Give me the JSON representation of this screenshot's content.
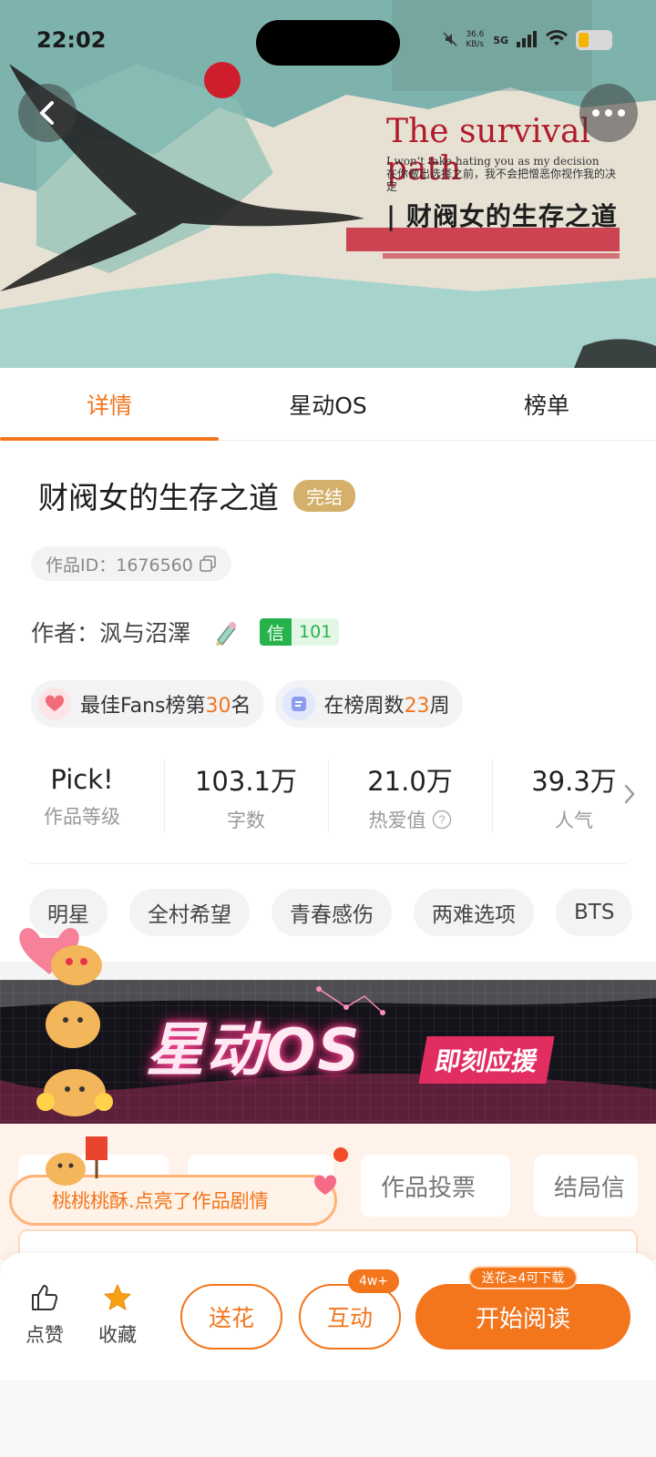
{
  "status_bar": {
    "time": "22:02",
    "net_speed": "36.6 KB/s",
    "network": "5G"
  },
  "cover": {
    "title_en": "The survival path",
    "subtitle_en": "I won't take hating you as my decision",
    "subtitle_cn": "在你做出选择之前，我不会把憎恶你视作我的决定",
    "title_cn": "| 财阀女的生存之道"
  },
  "tabs": [
    {
      "label": "详情"
    },
    {
      "label": "星动OS"
    },
    {
      "label": "榜单"
    }
  ],
  "book": {
    "title": "财阀女的生存之道",
    "status_badge": "完结",
    "id_label": "作品ID：1676560",
    "author_label": "作者：沨与沼澤",
    "credit_label": "信",
    "credit_value": "101"
  },
  "ranks": [
    {
      "prefix": "最佳Fans榜第",
      "num": "30",
      "suffix": "名"
    },
    {
      "prefix": "在榜周数",
      "num": "23",
      "suffix": "周"
    }
  ],
  "stats": [
    {
      "value": "Pick!",
      "label": "作品等级"
    },
    {
      "value": "103.1万",
      "label": "字数"
    },
    {
      "value": "21.0万",
      "label": "热爱值"
    },
    {
      "value": "39.3万",
      "label": "人气"
    }
  ],
  "tags": [
    "明星",
    "全村希望",
    "青春感伤",
    "两难选项",
    "BTS"
  ],
  "banner": {
    "title": "星动OS",
    "cta": "即刻应援"
  },
  "lower_tabs": [
    "作品投票",
    "结局信"
  ],
  "toast": "桃桃桃酥.点亮了作品剧情",
  "bottom_bar": {
    "like": "点赞",
    "favorite": "收藏",
    "flower": "送花",
    "interact": "互动",
    "interact_badge": "4w+",
    "read": "开始阅读",
    "read_badge": "送花≥4可下载"
  },
  "colors": {
    "accent": "#f3751c",
    "badge_gold": "#d4b06a",
    "credit_green": "#27b34b"
  }
}
